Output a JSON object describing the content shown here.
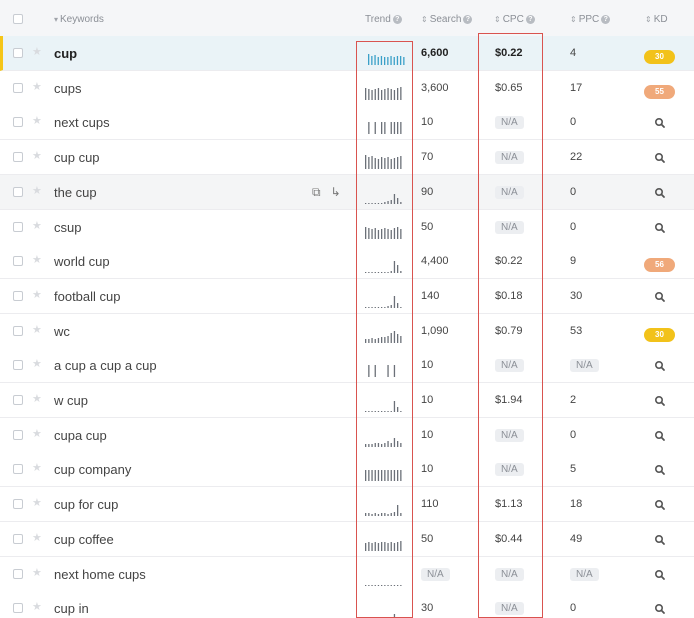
{
  "header": {
    "keywords": "Keywords",
    "trend": "Trend",
    "search": "Search",
    "cpc": "CPC",
    "ppc": "PPC",
    "kd": "KD",
    "help": "?"
  },
  "rows": [
    {
      "keyword": "cup",
      "trend": [
        0.55,
        0.45,
        0.5,
        0.4,
        0.45,
        0.4,
        0.4,
        0.45,
        0.4,
        0.45,
        0.45,
        0.4
      ],
      "search": "6,600",
      "cpc": "$0.22",
      "ppc": "4",
      "kd": "30",
      "kd_color": "#f2c21a"
    },
    {
      "keyword": "cups",
      "trend": [
        0.6,
        0.55,
        0.5,
        0.55,
        0.6,
        0.5,
        0.55,
        0.6,
        0.55,
        0.5,
        0.6,
        0.65
      ],
      "search": "3,600",
      "cpc": "$0.65",
      "ppc": "17",
      "kd": "55",
      "kd_color": "#f0a97a"
    },
    {
      "keyword": "next cups",
      "trend": [
        0,
        0.6,
        0,
        0.6,
        0,
        0.6,
        0.6,
        0,
        0.6,
        0.6,
        0.6,
        0.6
      ],
      "search": "10",
      "cpc": "N/A",
      "ppc": "0",
      "kd": null
    },
    {
      "keyword": "cup cup",
      "trend": [
        0.7,
        0.6,
        0.65,
        0.55,
        0.5,
        0.6,
        0.55,
        0.6,
        0.5,
        0.55,
        0.6,
        0.65
      ],
      "search": "70",
      "cpc": "N/A",
      "ppc": "22",
      "kd": null
    },
    {
      "keyword": "the cup",
      "trend": [
        0.05,
        0.05,
        0.05,
        0.05,
        0.05,
        0.05,
        0.1,
        0.15,
        0.2,
        0.5,
        0.3,
        0.1
      ],
      "search": "90",
      "cpc": "N/A",
      "ppc": "0",
      "kd": null
    },
    {
      "keyword": "csup",
      "trend": [
        0.6,
        0.55,
        0.5,
        0.55,
        0.45,
        0.5,
        0.55,
        0.5,
        0.45,
        0.55,
        0.6,
        0.5
      ],
      "search": "50",
      "cpc": "N/A",
      "ppc": "0",
      "kd": null
    },
    {
      "keyword": "world cup",
      "trend": [
        0.05,
        0.05,
        0.05,
        0.05,
        0.05,
        0.05,
        0.05,
        0.05,
        0.1,
        0.6,
        0.4,
        0.1
      ],
      "search": "4,400",
      "cpc": "$0.22",
      "ppc": "9",
      "kd": "56",
      "kd_color": "#f0a97a"
    },
    {
      "keyword": "football cup",
      "trend": [
        0.05,
        0.05,
        0.05,
        0.05,
        0.05,
        0.05,
        0.05,
        0.1,
        0.15,
        0.6,
        0.25,
        0.05
      ],
      "search": "140",
      "cpc": "$0.18",
      "ppc": "30",
      "kd": null
    },
    {
      "keyword": "wc",
      "trend": [
        0.2,
        0.2,
        0.25,
        0.2,
        0.25,
        0.3,
        0.3,
        0.35,
        0.5,
        0.6,
        0.45,
        0.35
      ],
      "search": "1,090",
      "cpc": "$0.79",
      "ppc": "53",
      "kd": "30",
      "kd_color": "#f2c21a"
    },
    {
      "keyword": "a cup a cup a cup",
      "trend": [
        0,
        0.6,
        0,
        0.6,
        0,
        0,
        0,
        0.6,
        0,
        0.6,
        0,
        0
      ],
      "search": "10",
      "cpc": "N/A",
      "ppc": "N/A",
      "kd": null
    },
    {
      "keyword": "w cup",
      "trend": [
        0.05,
        0.05,
        0.05,
        0.05,
        0.05,
        0.05,
        0.05,
        0.05,
        0.05,
        0.55,
        0.25,
        0.05
      ],
      "search": "10",
      "cpc": "$1.94",
      "ppc": "2",
      "kd": null
    },
    {
      "keyword": "cupa cup",
      "trend": [
        0.15,
        0.15,
        0.15,
        0.2,
        0.2,
        0.15,
        0.2,
        0.3,
        0.2,
        0.45,
        0.3,
        0.2
      ],
      "search": "10",
      "cpc": "N/A",
      "ppc": "0",
      "kd": null
    },
    {
      "keyword": "cup company",
      "trend": [
        0.55,
        0.55,
        0.55,
        0.55,
        0.55,
        0.55,
        0.55,
        0.55,
        0.55,
        0.55,
        0.55,
        0.55
      ],
      "search": "10",
      "cpc": "N/A",
      "ppc": "5",
      "kd": null
    },
    {
      "keyword": "cup for cup",
      "trend": [
        0.15,
        0.15,
        0.1,
        0.15,
        0.1,
        0.15,
        0.15,
        0.1,
        0.15,
        0.2,
        0.55,
        0.15
      ],
      "search": "110",
      "cpc": "$1.13",
      "ppc": "18",
      "kd": null
    },
    {
      "keyword": "cup coffee",
      "trend": [
        0.4,
        0.45,
        0.4,
        0.45,
        0.4,
        0.45,
        0.45,
        0.4,
        0.45,
        0.4,
        0.45,
        0.5
      ],
      "search": "50",
      "cpc": "$0.44",
      "ppc": "49",
      "kd": null
    },
    {
      "keyword": "next home cups",
      "trend": [
        0.04,
        0.04,
        0.04,
        0.04,
        0.04,
        0.04,
        0.04,
        0.04,
        0.04,
        0.04,
        0.04,
        0.04
      ],
      "search": "N/A",
      "cpc": "N/A",
      "ppc": "N/A",
      "kd": null
    },
    {
      "keyword": "cup in",
      "trend": [
        0.05,
        0.05,
        0.05,
        0.05,
        0.1,
        0.05,
        0.05,
        0.1,
        0.1,
        0.3,
        0.15,
        0.05
      ],
      "search": "30",
      "cpc": "N/A",
      "ppc": "0",
      "kd": null
    }
  ],
  "colors": {
    "trend_active": "#3aa0c8",
    "trend_normal": "#6b7078",
    "highlight_box": "#d9534f",
    "active_row_accent": "#f5c518"
  },
  "icons": {
    "sort": "sort-arrows-icon",
    "star": "star-icon",
    "copy": "copy-icon",
    "share": "share-arrow-icon",
    "kd_search": "magnifier-icon"
  }
}
